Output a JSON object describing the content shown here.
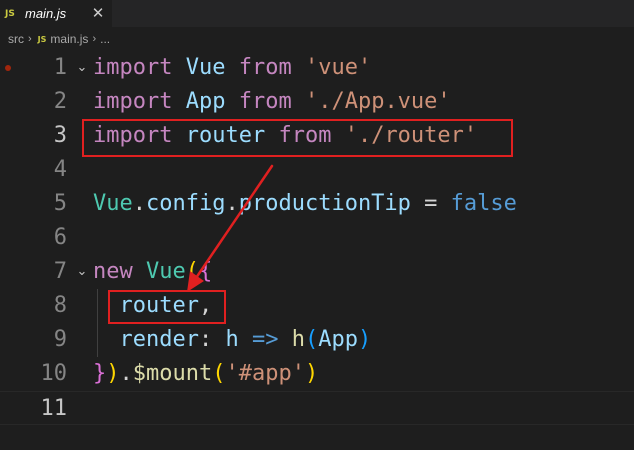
{
  "tab": {
    "badge": "JS",
    "title": "main.js",
    "close": "✕"
  },
  "breadcrumb": {
    "folder": "src",
    "sep": "›",
    "badge": "JS",
    "file": "main.js",
    "more": "..."
  },
  "lines": [
    {
      "number": "1",
      "tokens": [
        {
          "t": "import",
          "c": "kw"
        },
        {
          "t": " ",
          "c": "op"
        },
        {
          "t": "Vue",
          "c": "var"
        },
        {
          "t": " ",
          "c": "op"
        },
        {
          "t": "from",
          "c": "kw"
        },
        {
          "t": " ",
          "c": "op"
        },
        {
          "t": "'vue'",
          "c": "str"
        }
      ]
    },
    {
      "number": "2",
      "tokens": [
        {
          "t": "import",
          "c": "kw"
        },
        {
          "t": " ",
          "c": "op"
        },
        {
          "t": "App",
          "c": "var"
        },
        {
          "t": " ",
          "c": "op"
        },
        {
          "t": "from",
          "c": "kw"
        },
        {
          "t": " ",
          "c": "op"
        },
        {
          "t": "'./App.vue'",
          "c": "str"
        }
      ]
    },
    {
      "number": "3",
      "tokens": [
        {
          "t": "import",
          "c": "kw"
        },
        {
          "t": " ",
          "c": "op"
        },
        {
          "t": "router",
          "c": "var"
        },
        {
          "t": " ",
          "c": "op"
        },
        {
          "t": "from",
          "c": "kw"
        },
        {
          "t": " ",
          "c": "op"
        },
        {
          "t": "'./router'",
          "c": "str"
        }
      ]
    },
    {
      "number": "4",
      "tokens": []
    },
    {
      "number": "5",
      "tokens": [
        {
          "t": "Vue",
          "c": "cls"
        },
        {
          "t": ".",
          "c": "op"
        },
        {
          "t": "config",
          "c": "var"
        },
        {
          "t": ".",
          "c": "op"
        },
        {
          "t": "productionTip",
          "c": "var"
        },
        {
          "t": " = ",
          "c": "op"
        },
        {
          "t": "false",
          "c": "bool"
        }
      ]
    },
    {
      "number": "6",
      "tokens": []
    },
    {
      "number": "7",
      "tokens": [
        {
          "t": "new",
          "c": "kw"
        },
        {
          "t": " ",
          "c": "op"
        },
        {
          "t": "Vue",
          "c": "cls"
        },
        {
          "t": "(",
          "c": "bk1"
        },
        {
          "t": "{",
          "c": "bk2"
        }
      ]
    },
    {
      "number": "8",
      "tokens": [
        {
          "t": "  ",
          "c": "op"
        },
        {
          "t": "router",
          "c": "var"
        },
        {
          "t": ",",
          "c": "op"
        }
      ]
    },
    {
      "number": "9",
      "tokens": [
        {
          "t": "  ",
          "c": "op"
        },
        {
          "t": "render",
          "c": "var"
        },
        {
          "t": ": ",
          "c": "op"
        },
        {
          "t": "h",
          "c": "var"
        },
        {
          "t": " ",
          "c": "op"
        },
        {
          "t": "=>",
          "c": "bool"
        },
        {
          "t": " ",
          "c": "op"
        },
        {
          "t": "h",
          "c": "fn"
        },
        {
          "t": "(",
          "c": "bk3"
        },
        {
          "t": "App",
          "c": "var"
        },
        {
          "t": ")",
          "c": "bk3"
        }
      ]
    },
    {
      "number": "10",
      "tokens": [
        {
          "t": "}",
          "c": "bk2"
        },
        {
          "t": ")",
          "c": "bk1"
        },
        {
          "t": ".",
          "c": "op"
        },
        {
          "t": "$mount",
          "c": "fn"
        },
        {
          "t": "(",
          "c": "bk1"
        },
        {
          "t": "'#app'",
          "c": "str"
        },
        {
          "t": ")",
          "c": "bk1"
        }
      ]
    },
    {
      "number": "11",
      "tokens": []
    }
  ],
  "fold_icon": "⌄",
  "colors": {
    "background": "#1e1e1e",
    "annotation": "#e02020",
    "keyword": "#c586c0",
    "variable": "#9cdcfe",
    "string": "#ce9178"
  }
}
